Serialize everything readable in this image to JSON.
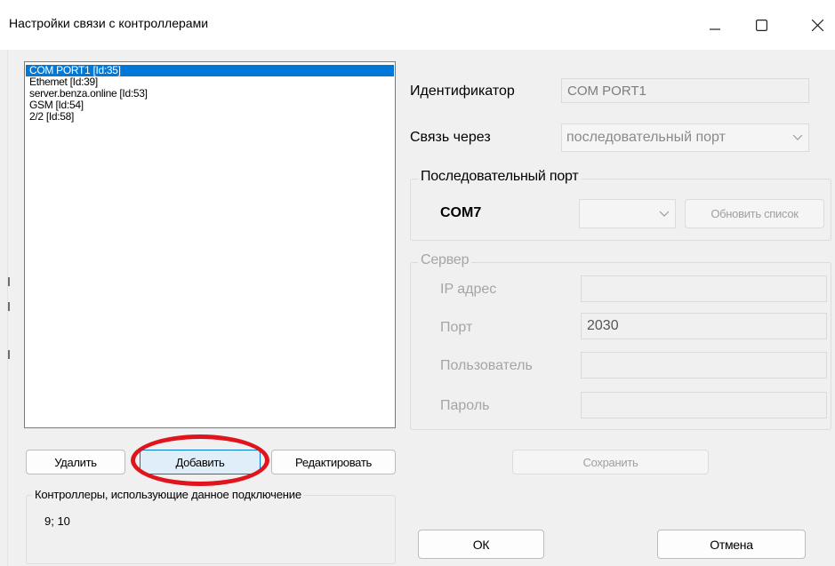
{
  "window": {
    "title": "Настройки связи с контроллерами"
  },
  "connections": [
    {
      "label": "COM PORT1 [Id:35]",
      "selected": true
    },
    {
      "label": "Ethemet [Id:39]",
      "selected": false
    },
    {
      "label": "server.benza.online [Id:53]",
      "selected": false
    },
    {
      "label": "GSM [Id:54]",
      "selected": false
    },
    {
      "label": "2/2 [Id:58]",
      "selected": false
    }
  ],
  "list_buttons": {
    "delete": "Удалить",
    "add": "Добавить",
    "edit": "Редактировать"
  },
  "controllers_group": {
    "legend": "Контроллеры, использующие данное подключение",
    "value": "9; 10"
  },
  "details": {
    "identifier_label": "Идентификатор",
    "identifier_value": "COM PORT1",
    "connect_via_label": "Связь через",
    "connect_via_value": "последовательный порт"
  },
  "serial_group": {
    "legend": "Последовательный порт",
    "port_name": "COM7",
    "port_select_value": "",
    "refresh_button": "Обновить список"
  },
  "server_group": {
    "legend": "Сервер",
    "ip_label": "IP адрес",
    "ip_value": "",
    "port_label": "Порт",
    "port_value": "2030",
    "user_label": "Пользователь",
    "user_value": "",
    "password_label": "Пароль",
    "password_value": ""
  },
  "actions": {
    "save": "Сохранить",
    "ok": "ОК",
    "cancel": "Отмена"
  },
  "colors": {
    "selection": "#0078d7",
    "highlight_ring": "#e0141c",
    "primary_border": "#0078d4"
  }
}
